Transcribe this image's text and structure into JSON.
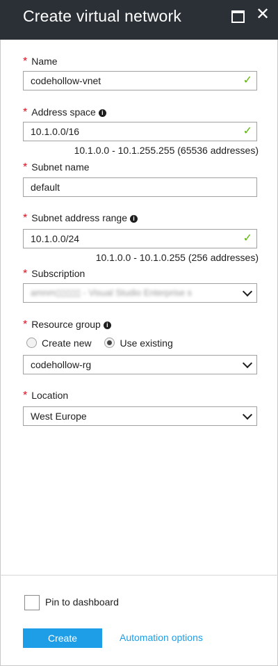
{
  "header": {
    "title": "Create virtual network"
  },
  "form": {
    "required_mark": "*",
    "name": {
      "label": "Name",
      "value": "codehollow-vnet"
    },
    "address_space": {
      "label": "Address space",
      "value": "10.1.0.0/16",
      "hint": "10.1.0.0 - 10.1.255.255 (65536 addresses)"
    },
    "subnet_name": {
      "label": "Subnet name",
      "value": "default"
    },
    "subnet_range": {
      "label": "Subnet address range",
      "value": "10.1.0.0/24",
      "hint": "10.1.0.0 - 10.1.0.255 (256 addresses)"
    },
    "subscription": {
      "label": "Subscription",
      "value": "amnm▯▯▯▯▯ - Visual Studio Enterprise s"
    },
    "resource_group": {
      "label": "Resource group",
      "create_new": "Create new",
      "use_existing": "Use existing",
      "selected": "use_existing",
      "value": "codehollow-rg"
    },
    "location": {
      "label": "Location",
      "value": "West Europe"
    }
  },
  "footer": {
    "pin_label": "Pin to dashboard",
    "create_label": "Create",
    "automation_label": "Automation options"
  },
  "colors": {
    "header_bg": "#2b2f36",
    "accent": "#1e9ee6",
    "required": "#e00b1c",
    "valid": "#5cb800"
  },
  "icons": {
    "info": "info-icon",
    "check": "checkmark-icon",
    "dropdown": "chevron-down-icon",
    "maximize": "maximize-icon",
    "close": "close-icon"
  }
}
